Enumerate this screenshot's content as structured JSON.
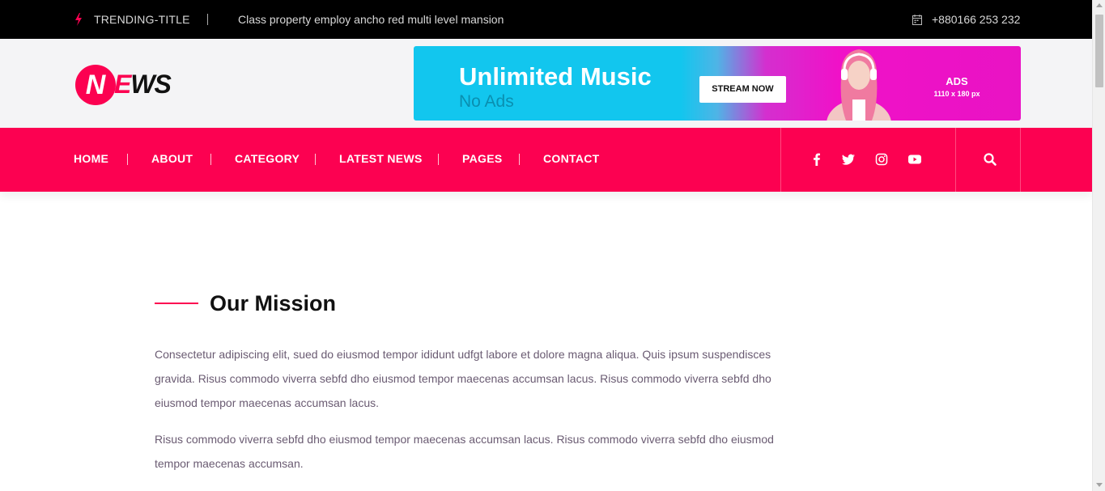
{
  "topbar": {
    "trending_label": "TRENDING-TITLE",
    "headline": "Class property employ ancho red multi level mansion",
    "phone": "+880166 253 232",
    "icons": [
      "bolt-icon",
      "calendar-icon"
    ]
  },
  "logo": {
    "n": "N",
    "e": "E",
    "ws": "WS"
  },
  "ad": {
    "title": "Unlimited Music",
    "subtitle": "No Ads",
    "button": "STREAM NOW",
    "label": "ADS",
    "size": "1110 x 180 px"
  },
  "nav": {
    "items": [
      "HOME",
      "ABOUT",
      "CATEGORY",
      "LATEST NEWS",
      "PAGES",
      "CONTACT"
    ],
    "social_icons": [
      "facebook-icon",
      "twitter-icon",
      "instagram-icon",
      "youtube-icon"
    ],
    "search_icon": "search-icon"
  },
  "content": {
    "title": "Our Mission",
    "paragraphs": [
      "Consectetur adipiscing elit, sued do eiusmod tempor ididunt udfgt labore et dolore magna aliqua. Quis ipsum suspendisces gravida. Risus commodo viverra sebfd dho eiusmod tempor maecenas accumsan lacus. Risus commodo viverra sebfd dho eiusmod tempor maecenas accumsan lacus.",
      "Risus commodo viverra sebfd dho eiusmod tempor maecenas accumsan lacus. Risus commodo viverra sebfd dho eiusmod tempor maecenas accumsan."
    ]
  },
  "colors": {
    "accent": "#fc0151",
    "topbar_bg": "#000000",
    "header_bg": "#f4f4f6"
  }
}
